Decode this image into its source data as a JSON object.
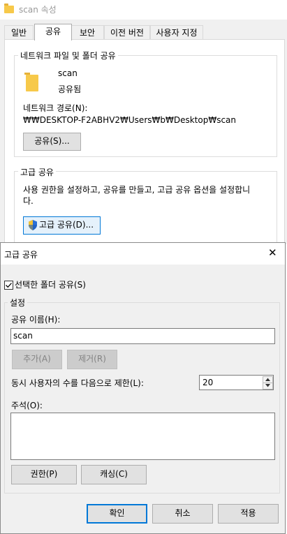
{
  "properties_window": {
    "title": "scan 속성",
    "tabs": [
      {
        "label": "일반"
      },
      {
        "label": "공유",
        "active": true
      },
      {
        "label": "보안"
      },
      {
        "label": "이전 버전"
      },
      {
        "label": "사용자 지정"
      }
    ],
    "network_share_group": {
      "title": "네트워크 파일 및 폴더 공유",
      "folder_name": "scan",
      "share_status": "공유됨",
      "path_label": "네트워크 경로(N):",
      "path_value": "₩₩DESKTOP-F2ABHV2₩Users₩b₩Desktop₩scan",
      "share_button": "공유(S)..."
    },
    "advanced_group": {
      "title": "고급 공유",
      "description_line1": "사용 권한을 설정하고, 공유를 만들고, 고급 공유 옵션을 설정합니",
      "description_line2": "다.",
      "advanced_button": "고급 공유(D)..."
    }
  },
  "advanced_dialog": {
    "title": "고급 공유",
    "close_glyph": "✕",
    "share_checkbox_label": "선택한 폴더 공유(S)",
    "share_checked": true,
    "settings_group_title": "설정",
    "share_name_label": "공유 이름(H):",
    "share_name_value": "scan",
    "add_button": "추가(A)",
    "remove_button": "제거(R)",
    "limit_label": "동시 사용자의 수를 다음으로 제한(L):",
    "limit_value": "20",
    "comment_label": "주석(O):",
    "comment_value": "",
    "permissions_button": "권한(P)",
    "caching_button": "캐싱(C)",
    "ok_button": "확인",
    "cancel_button": "취소",
    "apply_button": "적용"
  },
  "colors": {
    "accent": "#0078d7",
    "folder": "#f7c94a",
    "window_bg": "#f0f0f0"
  }
}
